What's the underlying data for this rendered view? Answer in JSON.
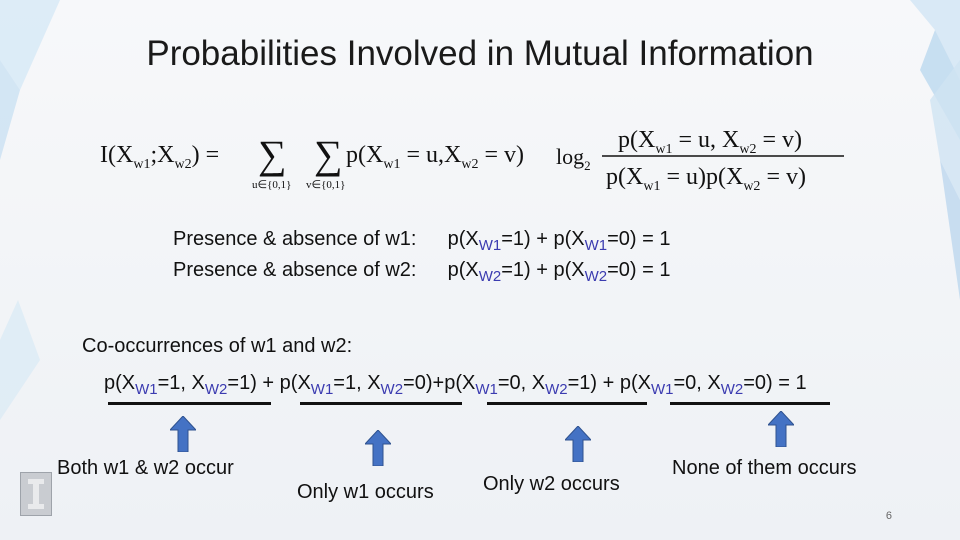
{
  "slide": {
    "title": "Probabilities Involved in Mutual Information",
    "page_number": "6"
  },
  "formula": {
    "lhs": "I(X",
    "sub_w1": "w1",
    "semi": ";X",
    "sub_w2": "w2",
    "eq": ") =",
    "sum_u": "u∈{0,1}",
    "sum_v": "v∈{0,1}",
    "joint_p": "p(X",
    "eq_u": " = u,X",
    "eq_v": " = v)",
    "log": "log",
    "log_base": "2",
    "num_p": "p(X",
    "num_u": " = u, X",
    "num_v": " = v)",
    "den_p": "p(X",
    "den_u": " = u)p(X",
    "den_v": " = v)"
  },
  "presence": [
    {
      "label": "Presence & absence of w1:",
      "p1": "p(X",
      "sub": "W1",
      "m1": "=1) + p(X",
      "m2": "=0) = 1"
    },
    {
      "label": "Presence & absence of w2:",
      "p1": "p(X",
      "sub": "W2",
      "m1": "=1) + p(X",
      "m2": "=0) = 1"
    }
  ],
  "cooccurrence": {
    "label": "Co-occurrences of w1 and w2:",
    "t1a": "p(X",
    "t1b": "=1, X",
    "t1c": "=1) + ",
    "t2a": "p(X",
    "t2b": "=1, X",
    "t2c": "=0)+",
    "t3a": "p(X",
    "t3b": "=0, X",
    "t3c": "=1) + ",
    "t4a": "p(X",
    "t4b": "=0, X",
    "t4c": "=0) = 1",
    "sub1": "W1",
    "sub2": "W2"
  },
  "captions": {
    "both": "Both w1 & w2 occur",
    "only_w1": "Only w1 occurs",
    "only_w2": "Only w2 occurs",
    "none": "None of them occurs"
  },
  "colors": {
    "arrow": "#4472c4",
    "subscript": "#3b3bb0"
  }
}
